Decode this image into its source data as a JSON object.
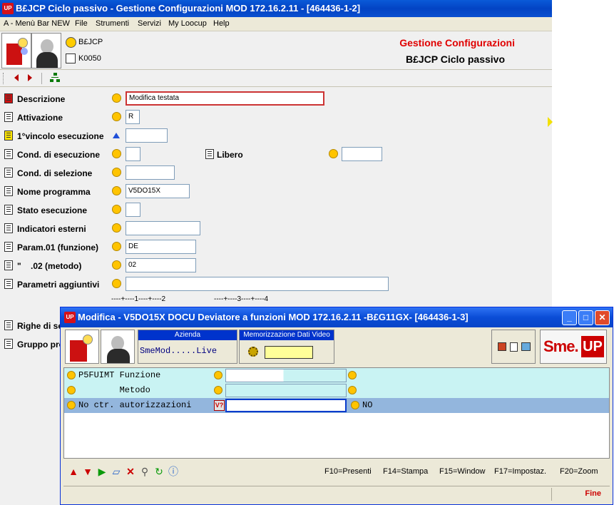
{
  "main_window": {
    "title": "B£JCP Ciclo passivo - Gestione Configurazioni MOD 172.16.2.11 - [464436-1-2]",
    "app_badge": "UP"
  },
  "menu": {
    "items": [
      "A - Menù Bar NEW",
      "File",
      "Strumenti",
      "Servizi",
      "My Loocup",
      "Help"
    ]
  },
  "header": {
    "code1": "B£JCP",
    "code2": "K0050",
    "title": "Gestione Configurazioni",
    "subtitle": "B£JCP Ciclo passivo"
  },
  "form": {
    "rows": [
      {
        "label": "Descrizione",
        "value": "Modifica testata"
      },
      {
        "label": "Attivazione",
        "value": "R"
      },
      {
        "label": "1°vincolo esecuzione",
        "value": ""
      },
      {
        "label": "Cond. di esecuzione",
        "value": ""
      },
      {
        "label": "Cond. di selezione",
        "value": ""
      },
      {
        "label": "Nome programma",
        "value": "V5DO15X"
      },
      {
        "label": "Stato esecuzione",
        "value": ""
      },
      {
        "label": "Indicatori esterni",
        "value": ""
      },
      {
        "label": "Param.01 (funzione)",
        "value": "DE"
      },
      {
        "label": "\"    .02 (metodo)",
        "value": "02"
      },
      {
        "label": "Parametri aggiuntivi",
        "value": ""
      }
    ],
    "libero_label": "Libero",
    "libero_value": "",
    "ruler1": "----+----1----+----2",
    "ruler2": "----+----3----+----4",
    "righe_label": "Righe di se",
    "gruppo_label": "Gruppo pro"
  },
  "dialog": {
    "title": "Modifica -  V5DO15X DOCU Deviatore a funzioni MOD 172.16.2.11 -B£G11GX- [464436-1-3]",
    "app_badge": "UP",
    "azienda_label": "Azienda",
    "azienda_value": "SmeMod.....Live",
    "memo_label": "Memorizzazione Dati Video",
    "logo_sme": "Sme.",
    "logo_up": "UP",
    "rows": [
      {
        "label": "P5FUIMT Funzione",
        "value": "",
        "result": ""
      },
      {
        "label": "        Metodo",
        "value": "",
        "result": ""
      },
      {
        "label": "No ctr. autorizzazioni",
        "value": "",
        "result": "NO"
      }
    ],
    "fkeys": [
      "F10=Presenti",
      "F14=Stampa",
      "F15=Window",
      "F17=Impostaz.",
      "F20=Zoom"
    ],
    "status": "Fine"
  },
  "colors": {
    "accent_red": "#cc0000",
    "title_blue": "#0a4fcf",
    "grid_cyan": "#c9f3f3",
    "selected_row": "#93b6dd"
  }
}
